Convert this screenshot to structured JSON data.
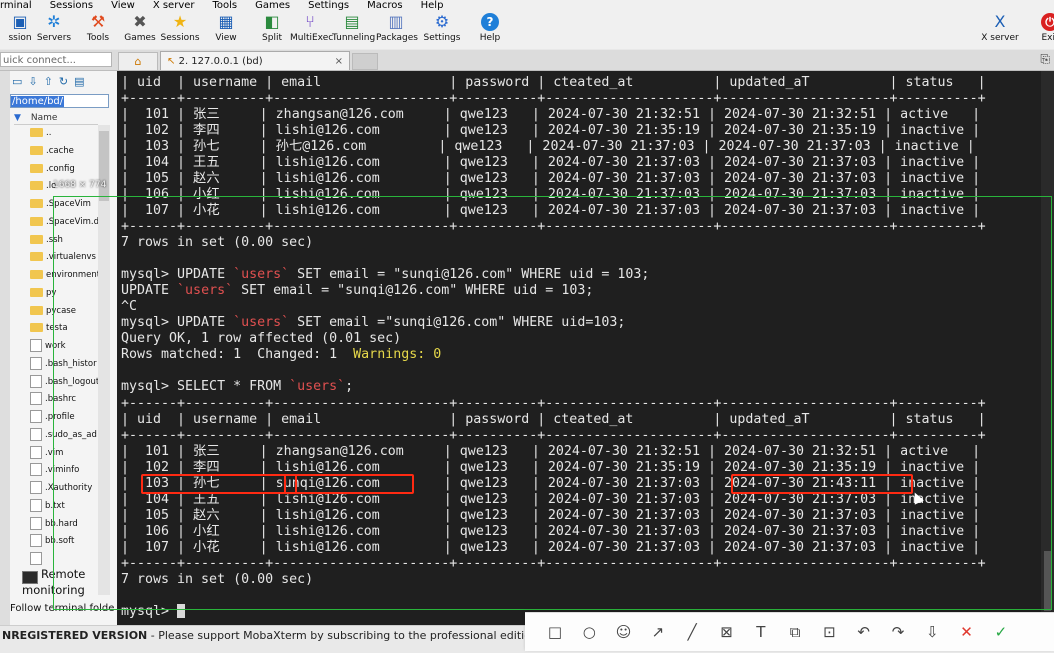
{
  "menu": [
    "rminal",
    "Sessions",
    "View",
    "X server",
    "Tools",
    "Games",
    "Settings",
    "Macros",
    "Help"
  ],
  "toolbar": [
    {
      "label": "ssion",
      "icon": "session-icon",
      "glyph": "▣"
    },
    {
      "label": "Servers",
      "icon": "servers-icon",
      "glyph": "✲"
    },
    {
      "label": "Tools",
      "icon": "tools-icon",
      "glyph": "⚒"
    },
    {
      "label": "Games",
      "icon": "games-icon",
      "glyph": "✖"
    },
    {
      "label": "Sessions",
      "icon": "star-icon",
      "glyph": "★"
    },
    {
      "label": "View",
      "icon": "view-icon",
      "glyph": "▦"
    },
    {
      "label": "Split",
      "icon": "split-icon",
      "glyph": "◧"
    },
    {
      "label": "MultiExec",
      "icon": "multiexec-icon",
      "glyph": "⑂"
    },
    {
      "label": "Tunneling",
      "icon": "tunneling-icon",
      "glyph": "▤"
    },
    {
      "label": "Packages",
      "icon": "packages-icon",
      "glyph": "▥"
    },
    {
      "label": "Settings",
      "icon": "settings-icon",
      "glyph": "⚙"
    },
    {
      "label": "Help",
      "icon": "help-icon",
      "glyph": "?"
    },
    {
      "label": "X server",
      "icon": "xserver-icon",
      "glyph": "X"
    },
    {
      "label": "Exit",
      "icon": "exit-icon",
      "glyph": "⏻"
    }
  ],
  "quick_connect": {
    "placeholder": "uick connect..."
  },
  "tab": {
    "title": "2. 127.0.0.1 (bd)"
  },
  "sidebar": {
    "path": "/home/bd/",
    "column": "Name",
    "files": [
      "..",
      ".cache",
      ".config",
      ".lo",
      ".SpaceVim",
      ".SpaceVim.d",
      ".ssh",
      ".virtualenvs",
      "environment",
      "py",
      "pycase",
      "testa",
      "work",
      ".bash_histor",
      ".bash_logout",
      ".bashrc",
      ".profile",
      ".sudo_as_ad",
      ".vim",
      ".viminfo",
      ".Xauthority",
      "b.txt",
      "bb.hard",
      "bb.soft",
      ""
    ],
    "remote_monitoring": [
      "Remote",
      "monitoring"
    ],
    "follow": "Follow terminal folde"
  },
  "overlay": {
    "dimensions": "1668 × 774"
  },
  "terminal": {
    "table_top": {
      "header": "| uid  | username | email                | password | cteated_at          | updated_aT          | status   |",
      "sep": "+------+----------+----------------------+----------+---------------------+---------------------+----------+",
      "rows": [
        "|  101 | 张三     | zhangsan@126.com     | qwe123   | 2024-07-30 21:32:51 | 2024-07-30 21:32:51 | active   |",
        "|  102 | 李四     | lishi@126.com        | qwe123   | 2024-07-30 21:35:19 | 2024-07-30 21:35:19 | inactive |",
        "|  103 | 孙七     | 孙七@126.com         | qwe123   | 2024-07-30 21:37:03 | 2024-07-30 21:37:03 | inactive |",
        "|  104 | 王五     | lishi@126.com        | qwe123   | 2024-07-30 21:37:03 | 2024-07-30 21:37:03 | inactive |",
        "|  105 | 赵六     | lishi@126.com        | qwe123   | 2024-07-30 21:37:03 | 2024-07-30 21:37:03 | inactive |",
        "|  106 | 小红     | lishi@126.com        | qwe123   | 2024-07-30 21:37:03 | 2024-07-30 21:37:03 | inactive |",
        "|  107 | 小花     | lishi@126.com        | qwe123   | 2024-07-30 21:37:03 | 2024-07-30 21:37:03 | inactive |"
      ]
    },
    "rows_msg_1": "7 rows in set (0.00 sec)",
    "cmd1_prefix": "mysql> UPDATE ",
    "cmd1_table": "`users`",
    "cmd1_suffix": " SET email = \"sunqi@126.com\" WHERE uid = 103;",
    "cmd2_prefix": "UPDATE ",
    "cmd2_table": "`users`",
    "cmd2_suffix": " SET email = \"sunqi@126.com\" WHERE uid = 103;",
    "ctrl_c": "^C",
    "cmd3_prefix": "mysql> UPDATE ",
    "cmd3_table": "`users`",
    "cmd3_suffix": " SET email =\"sunqi@126.com\" WHERE uid=103;",
    "query_ok": "Query OK, 1 row affected (0.01 sec)",
    "rows_matched": "Rows matched: 1  Changed: 1  ",
    "warnings": "Warnings: 0",
    "select_prefix": "mysql> SELECT * FROM ",
    "select_table": "`users`",
    "select_suffix": ";",
    "table_bottom": {
      "rows": [
        "|  101 | 张三     | zhangsan@126.com     | qwe123   | 2024-07-30 21:32:51 | 2024-07-30 21:32:51 | active   |",
        "|  102 | 李四     | lishi@126.com        | qwe123   | 2024-07-30 21:35:19 | 2024-07-30 21:35:19 | inactive |",
        "|  103 | 孙七     | sunqi@126.com        | qwe123   | 2024-07-30 21:37:03 | 2024-07-30 21:43:11 | inactive |",
        "|  104 | 王五     | lishi@126.com        | qwe123   | 2024-07-30 21:37:03 | 2024-07-30 21:37:03 | inactive |",
        "|  105 | 赵六     | lishi@126.com        | qwe123   | 2024-07-30 21:37:03 | 2024-07-30 21:37:03 | inactive |",
        "|  106 | 小红     | lishi@126.com        | qwe123   | 2024-07-30 21:37:03 | 2024-07-30 21:37:03 | inactive |",
        "|  107 | 小花     | lishi@126.com        | qwe123   | 2024-07-30 21:37:03 | 2024-07-30 21:37:03 | inactive |"
      ]
    },
    "rows_msg_2": "7 rows in set (0.00 sec)",
    "prompt": "mysql> "
  },
  "status": {
    "left": "NREGISTERED VERSION",
    "right": "  -  Please support MobaXterm by subscribing to the professional edition h"
  },
  "annotation_tools": [
    "rectangle-tool-icon",
    "ellipse-tool-icon",
    "emoji-tool-icon",
    "arrow-tool-icon",
    "pen-tool-icon",
    "mosaic-tool-icon",
    "text-tool-icon",
    "copy-tool-icon",
    "ocr-tool-icon",
    "undo-icon",
    "share-icon",
    "download-icon",
    "cancel-icon",
    "confirm-icon"
  ],
  "colors": {
    "terminal_bg": "#1f1f1f",
    "highlight_box": "#ff2a12",
    "table_name": "#e05050",
    "warning": "#e6d84a",
    "frame": "#29b43b"
  }
}
